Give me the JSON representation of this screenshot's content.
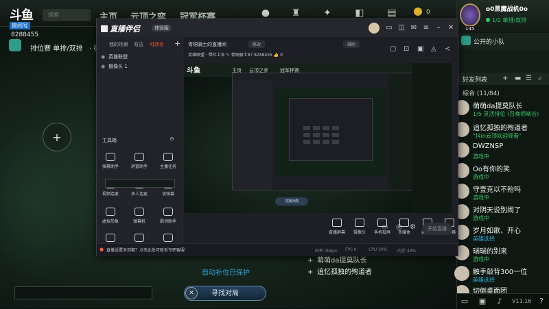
{
  "client": {
    "logo_text": "斗鱼",
    "logo_tag": "房间号",
    "room_id": "8288455",
    "search_placeholder": "搜索",
    "nav": [
      "主页",
      "云顶之弈",
      "冠军杯赛"
    ],
    "coin_count": "0",
    "mode_label": "排位赛 单排/双排",
    "mode_label_extra": "· 征",
    "protect_text": "自动补位已保护",
    "find_match_label": "寻找对局",
    "find_close": "✕",
    "bottom_friends": [
      "萌萌da提莫队长",
      "追忆孤独的殉道者"
    ]
  },
  "profile": {
    "name": "o0黑魔战机0o",
    "status": "1/2 单排/双排",
    "level": "145"
  },
  "party": {
    "label": "公开的小队"
  },
  "friends_header": "好友列表",
  "group_label": "综合 (11/84)",
  "friends": [
    {
      "name": "萌萌da提莫队长",
      "status": "1/5 灵活排位 (召唤师峡谷)",
      "color": "green"
    },
    {
      "name": "追忆孤独的殉道者",
      "status": "\"抖in云顶欢迎观看\"",
      "color": "green"
    },
    {
      "name": "DWZNSP",
      "status": "游戏中",
      "color": "green"
    },
    {
      "name": "Oo有你的笑",
      "status": "游戏中",
      "color": "green"
    },
    {
      "name": "守壹克以不殆吗",
      "status": "游戏中",
      "color": "green"
    },
    {
      "name": "对阴天说别闹了",
      "status": "游戏中",
      "color": "green"
    },
    {
      "name": "岁月如歌、开心",
      "status": "英雄选择",
      "color": "blue"
    },
    {
      "name": "瑞瑞的别来",
      "status": "游戏中",
      "color": "green"
    },
    {
      "name": "触手敲背300一位",
      "status": "英雄选择",
      "color": "blue"
    },
    {
      "name": "切倒桌面团",
      "status": "",
      "color": "green"
    }
  ],
  "version": "V11.16",
  "stream_app": {
    "title": "直播伴侣",
    "tag": "体验版",
    "tabs": [
      "我的场景",
      "双击",
      "可改名"
    ],
    "sources": [
      "英雄联盟",
      "摄像头 1"
    ],
    "tools_title": "工具箱",
    "tools": [
      "弹幕助手",
      "房管助手",
      "主播任务",
      "视频连麦",
      "多人连麦",
      "读弹幕",
      "虚拟形象",
      "弹幕机",
      "歌词助手",
      "",
      ""
    ],
    "preview_title": "青铜骑士的直播间",
    "preview_btn1": "修改",
    "preview_btn2": "辅助",
    "preview_line2": "英雄联盟 · 帮社上车 ✎   青铜骑士87   8288455   👍 0",
    "preview_match_btn": "寻找对局",
    "controls": [
      "直播屏幕",
      "摄像头",
      "手机投屏",
      "多媒体",
      "麦克风",
      "扬声器"
    ],
    "live_button": "开始直播",
    "status_msg": "直播设置未到期？点击此处可联系专职客服",
    "stats": [
      "码率 0kbps",
      "FPS 0",
      "CPU 30%",
      "内存 49%"
    ]
  }
}
